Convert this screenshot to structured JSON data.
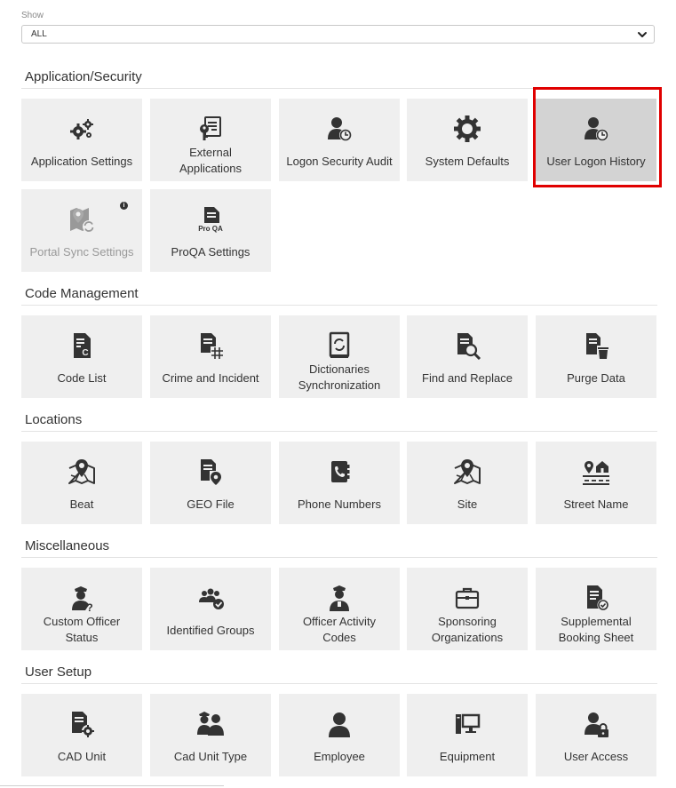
{
  "filter": {
    "label": "Show",
    "value": "ALL"
  },
  "sections": [
    {
      "title": "Application/Security",
      "tiles": [
        {
          "label": "Application Settings",
          "icon": "gears-icon"
        },
        {
          "label": "External Applications",
          "icon": "document-key-icon"
        },
        {
          "label": "Logon Security Audit",
          "icon": "user-clock-icon"
        },
        {
          "label": "System Defaults",
          "icon": "gear-icon"
        },
        {
          "label": "User Logon History",
          "icon": "user-clock-icon",
          "selected": true
        },
        {
          "label": "Portal Sync Settings",
          "icon": "map-sync-icon",
          "disabled": true
        },
        {
          "label": "ProQA Settings",
          "icon": "proqa-document-icon",
          "icon_text": "Pro QA"
        }
      ]
    },
    {
      "title": "Code Management",
      "tiles": [
        {
          "label": "Code List",
          "icon": "code-document-icon"
        },
        {
          "label": "Crime and Incident",
          "icon": "document-hash-icon"
        },
        {
          "label": "Dictionaries Synchronization",
          "icon": "sync-book-icon"
        },
        {
          "label": "Find and Replace",
          "icon": "document-search-icon"
        },
        {
          "label": "Purge Data",
          "icon": "document-trash-icon"
        }
      ]
    },
    {
      "title": "Locations",
      "tiles": [
        {
          "label": "Beat",
          "icon": "map-pin-icon"
        },
        {
          "label": "GEO File",
          "icon": "document-pin-icon"
        },
        {
          "label": "Phone Numbers",
          "icon": "phone-book-icon"
        },
        {
          "label": "Site",
          "icon": "map-pin-icon"
        },
        {
          "label": "Street Name",
          "icon": "street-house-icon"
        }
      ]
    },
    {
      "title": "Miscellaneous",
      "tiles": [
        {
          "label": "Custom Officer Status",
          "icon": "officer-question-icon"
        },
        {
          "label": "Identified Groups",
          "icon": "group-check-icon"
        },
        {
          "label": "Officer Activity Codes",
          "icon": "officer-icon"
        },
        {
          "label": "Sponsoring Organizations",
          "icon": "briefcase-icon"
        },
        {
          "label": "Supplemental Booking Sheet",
          "icon": "document-check-icon"
        }
      ]
    },
    {
      "title": "User Setup",
      "tiles": [
        {
          "label": "CAD Unit",
          "icon": "document-gear-icon"
        },
        {
          "label": "Cad Unit Type",
          "icon": "officers-icon"
        },
        {
          "label": "Employee",
          "icon": "user-icon"
        },
        {
          "label": "Equipment",
          "icon": "computer-icon"
        },
        {
          "label": "User Access",
          "icon": "user-lock-icon"
        }
      ]
    }
  ]
}
